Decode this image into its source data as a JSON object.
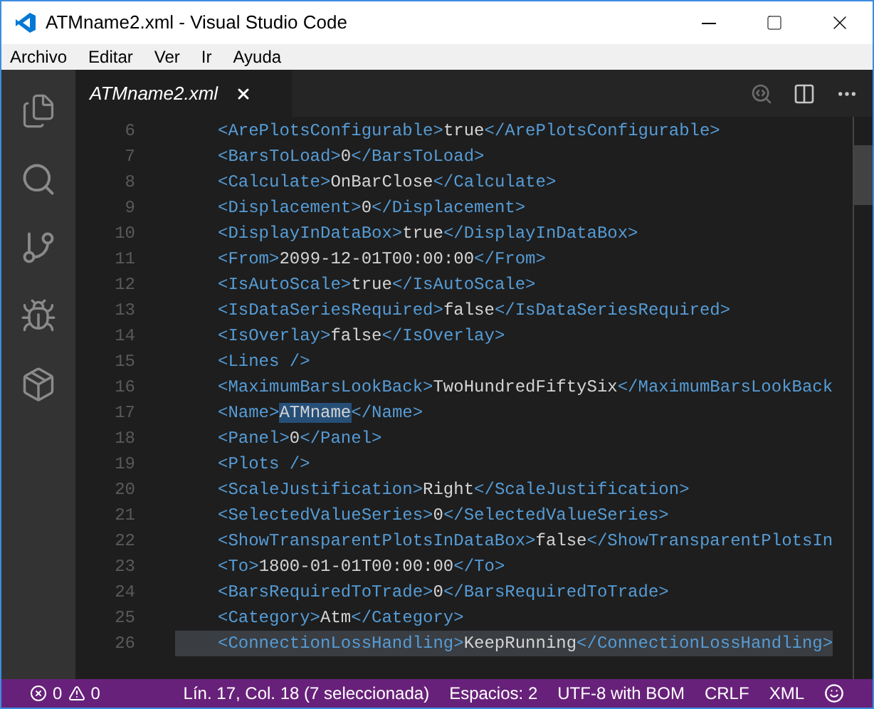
{
  "window": {
    "title": "ATMname2.xml - Visual Studio Code"
  },
  "menu": [
    "Archivo",
    "Editar",
    "Ver",
    "Ir",
    "Ayuda"
  ],
  "tabs": [
    {
      "label": "ATMname2.xml",
      "selected": true
    }
  ],
  "lines": [
    {
      "number": "6",
      "tag": "<ArePlotsConfigurable>",
      "value": "true",
      "close": "</ArePlotsConfigurable>"
    },
    {
      "number": "7",
      "tag": "<BarsToLoad>",
      "value": "0",
      "close": "</BarsToLoad>"
    },
    {
      "number": "8",
      "tag": "<Calculate>",
      "value": "OnBarClose",
      "close": "</Calculate>"
    },
    {
      "number": "9",
      "tag": "<Displacement>",
      "value": "0",
      "close": "</Displacement>"
    },
    {
      "number": "10",
      "tag": "<DisplayInDataBox>",
      "value": "true",
      "close": "</DisplayInDataBox>"
    },
    {
      "number": "11",
      "tag": "<From>",
      "value": "2099-12-01T00:00:00",
      "close": "</From>"
    },
    {
      "number": "12",
      "tag": "<IsAutoScale>",
      "value": "true",
      "close": "</IsAutoScale>"
    },
    {
      "number": "13",
      "tag": "<IsDataSeriesRequired>",
      "value": "false",
      "close": "</IsDataSeriesRequired>"
    },
    {
      "number": "14",
      "tag": "<IsOverlay>",
      "value": "false",
      "close": "</IsOverlay>"
    },
    {
      "number": "15",
      "tag": "<Lines />"
    },
    {
      "number": "16",
      "tag": "<MaximumBarsLookBack>",
      "value": "TwoHundredFiftySix",
      "close": "</MaximumBarsLookBack"
    },
    {
      "number": "17",
      "tag": "<Name>",
      "value": "ATMname",
      "close": "</Name>",
      "selected": true
    },
    {
      "number": "18",
      "tag": "<Panel>",
      "value": "0",
      "close": "</Panel>"
    },
    {
      "number": "19",
      "tag": "<Plots />"
    },
    {
      "number": "20",
      "tag": "<ScaleJustification>",
      "value": "Right",
      "close": "</ScaleJustification>"
    },
    {
      "number": "21",
      "tag": "<SelectedValueSeries>",
      "value": "0",
      "close": "</SelectedValueSeries>"
    },
    {
      "number": "22",
      "tag": "<ShowTransparentPlotsInDataBox>",
      "value": "false",
      "close": "</ShowTransparentPlotsIn"
    },
    {
      "number": "23",
      "tag": "<To>",
      "value": "1800-01-01T00:00:00",
      "close": "</To>"
    },
    {
      "number": "24",
      "tag": "<BarsRequiredToTrade>",
      "value": "0",
      "close": "</BarsRequiredToTrade>"
    },
    {
      "number": "25",
      "tag": "<Category>",
      "value": "Atm",
      "close": "</Category>"
    },
    {
      "number": "26",
      "tag": "<ConnectionLossHandling>",
      "value": "KeepRunning",
      "close": "</ConnectionLossHandling>",
      "highlighted": true
    }
  ],
  "status_bar": {
    "errors": "0",
    "warnings": "0",
    "position": "Lín. 17, Col. 18 (7 seleccionada)",
    "indent": "Espacios: 2",
    "encoding": "UTF-8 with BOM",
    "eol": "CRLF",
    "language": "XML"
  }
}
